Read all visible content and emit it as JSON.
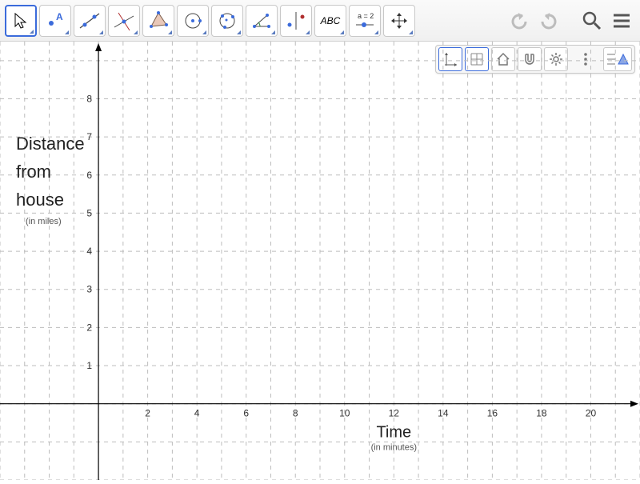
{
  "toolbar": {
    "tools": [
      {
        "name": "move-tool",
        "selected": true
      },
      {
        "name": "point-tool",
        "selected": false
      },
      {
        "name": "line-tool",
        "selected": false
      },
      {
        "name": "perpendicular-line-tool",
        "selected": false
      },
      {
        "name": "polygon-tool",
        "selected": false
      },
      {
        "name": "circle-center-point-tool",
        "selected": false
      },
      {
        "name": "circle-3points-tool",
        "selected": false
      },
      {
        "name": "angle-tool",
        "selected": false
      },
      {
        "name": "reflect-tool",
        "selected": false
      },
      {
        "name": "text-tool",
        "label": "ABC",
        "selected": false
      },
      {
        "name": "slider-tool",
        "label": "a = 2",
        "selected": false
      },
      {
        "name": "move-graphics-tool",
        "selected": false
      }
    ],
    "undo_enabled": false,
    "redo_enabled": false
  },
  "style_bar": {
    "buttons": [
      {
        "name": "show-axes",
        "active": true
      },
      {
        "name": "show-grid",
        "active": true
      },
      {
        "name": "home-view",
        "active": false
      },
      {
        "name": "snap-to-grid",
        "active": false
      },
      {
        "name": "settings",
        "active": false
      },
      {
        "name": "more",
        "active": false
      },
      {
        "name": "properties-panel",
        "active": false
      }
    ]
  },
  "chart_data": {
    "type": "scatter",
    "series": [],
    "x": {
      "label": "Time",
      "unit": "(in minutes)",
      "ticks": [
        2,
        4,
        6,
        8,
        10,
        12,
        14,
        16,
        18,
        20
      ],
      "range": [
        -4,
        22
      ]
    },
    "y": {
      "label_line1": "Distance",
      "label_line2": "from",
      "label_line3": "house",
      "unit": "(in miles)",
      "ticks": [
        1,
        2,
        3,
        4,
        5,
        6,
        7,
        8
      ],
      "range": [
        -2,
        9.5
      ]
    },
    "grid": true
  }
}
